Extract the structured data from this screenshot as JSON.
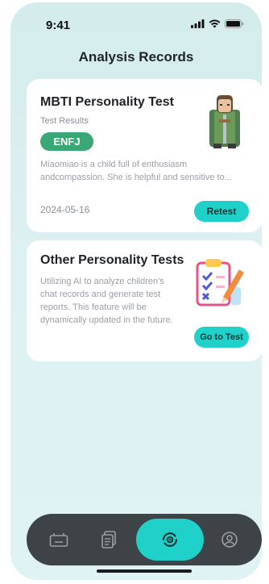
{
  "status_bar": {
    "time": "9:41"
  },
  "header": {
    "title": "Analysis Records"
  },
  "cards": [
    {
      "title": "MBTI Personality Test",
      "subtitle": "Test Results",
      "badge": "ENFJ",
      "description": "Miaomiao is a child full of enthusiasm andcompassion. She is helpful and sensitive to...",
      "date": "2024-05-16",
      "button": "Retest"
    },
    {
      "title": "Other Personality Tests",
      "description": "Utilizing AI to analyze children's chat records and generate test reports. This feature will be dynamically updated in the future.",
      "button": "Go to Test"
    }
  ],
  "tabbar": {
    "items": [
      {
        "icon": "robot-icon",
        "active": false
      },
      {
        "icon": "documents-icon",
        "active": false
      },
      {
        "icon": "analysis-eye-icon",
        "active": true
      },
      {
        "icon": "profile-icon",
        "active": false
      }
    ]
  },
  "colors": {
    "accent": "#1fd1c8",
    "badge": "#3aa876",
    "tabbar": "#3d4347",
    "background": "#d9eff0"
  }
}
